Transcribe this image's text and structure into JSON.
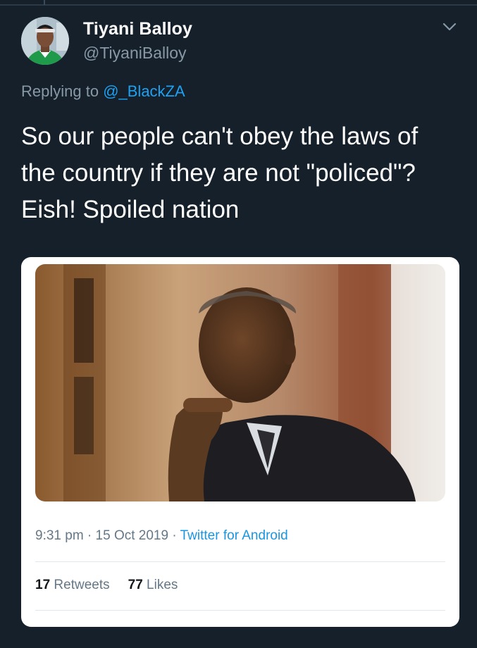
{
  "author": {
    "display_name": "Tiyani Balloy",
    "handle": "@TiyaniBalloy"
  },
  "reply_context": {
    "prefix": "Replying to ",
    "mention": "@_BlackZA"
  },
  "tweet": {
    "text": "So our people can't obey the laws of the country if they are not \"policed\"? Eish! Spoiled nation"
  },
  "meta": {
    "time": "9:31 pm",
    "separator": " · ",
    "date": "15 Oct 2019",
    "source": "Twitter for Android"
  },
  "stats": {
    "retweets_count": "17",
    "retweets_label": " Retweets",
    "likes_count": "77",
    "likes_label": " Likes"
  },
  "icons": {
    "menu": "chevron-down-icon"
  },
  "colors": {
    "background": "#15202b",
    "accent": "#1da1f2",
    "muted": "#8899a6"
  }
}
